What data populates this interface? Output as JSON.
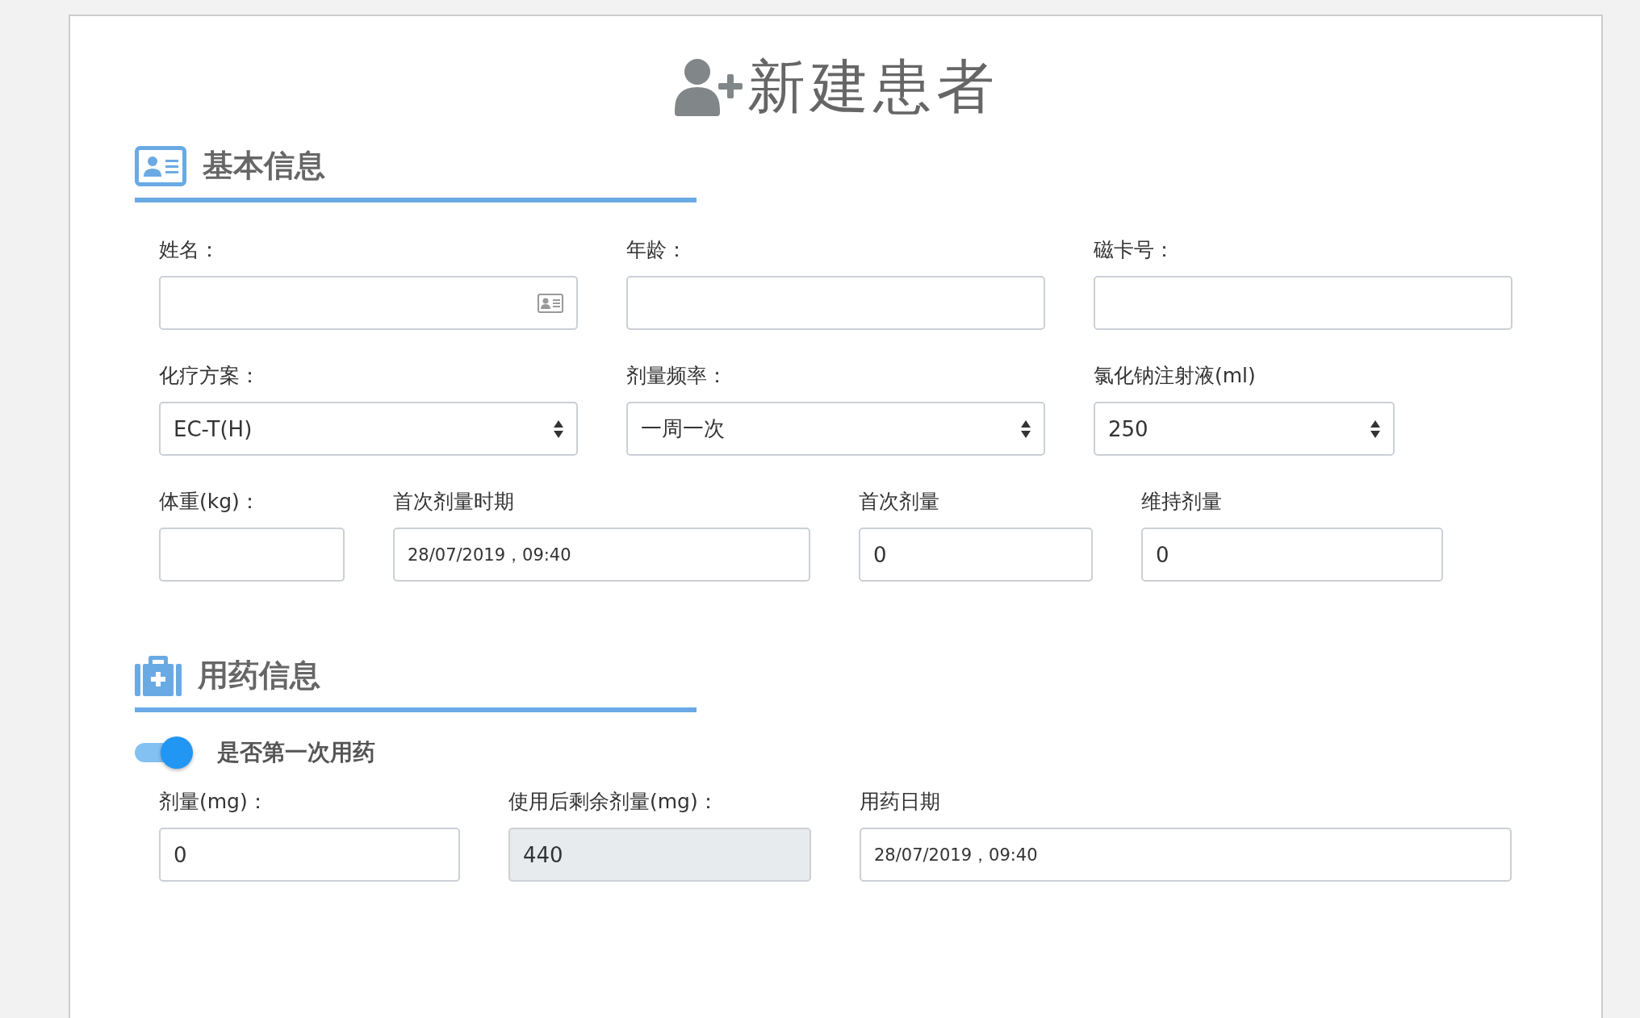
{
  "title": "新建患者",
  "sections": [
    {
      "kind": "basic",
      "title": "基本信息",
      "rows": [
        [
          {
            "label": "姓名：",
            "kind": "card-text"
          },
          {
            "label": "年龄：",
            "kind": "text"
          },
          {
            "label": "磁卡号：",
            "kind": "text"
          }
        ],
        [
          {
            "label": "化疗方案：",
            "kind": "select",
            "value": "EC-T(H)"
          },
          {
            "label": "剂量频率：",
            "kind": "select",
            "value": "一周一次"
          },
          {
            "label": "氯化钠注射液(ml)",
            "kind": "select",
            "value": "250"
          }
        ],
        [
          {
            "label": "体重(kg)：",
            "kind": "text"
          },
          {
            "label": "首次剂量时期",
            "kind": "date",
            "value": "28/07/2019，09:40"
          },
          {
            "label": "首次剂量",
            "kind": "text",
            "value": "0"
          },
          {
            "label": "维持剂量",
            "kind": "text",
            "value": "0"
          }
        ]
      ]
    },
    {
      "kind": "medication",
      "title": "用药信息",
      "toggle": {
        "label": "是否第一次用药",
        "on": true
      },
      "rows": [
        [
          {
            "label": "剂量(mg)：",
            "kind": "text",
            "value": "0"
          },
          {
            "label": "使用后剩余剂量(mg)：",
            "kind": "readonly",
            "value": "440"
          },
          {
            "label": "用药日期",
            "kind": "date",
            "value": "28/07/2019，09:40"
          }
        ]
      ]
    }
  ]
}
